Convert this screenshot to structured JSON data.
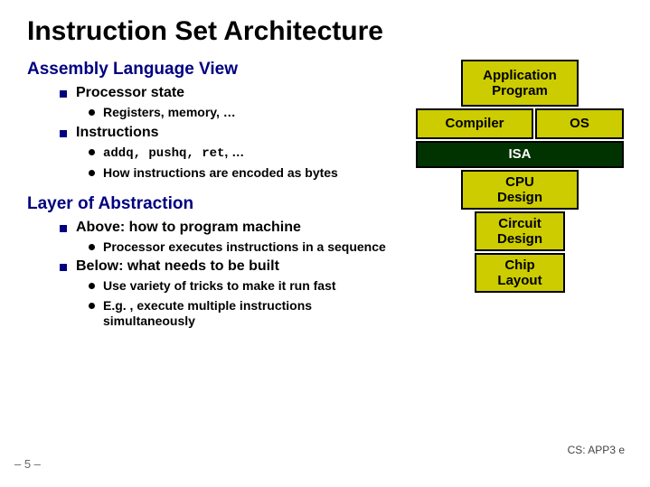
{
  "title": "Instruction Set Architecture",
  "section1": {
    "heading": "Assembly Language View",
    "item1": {
      "label": "Processor state",
      "sub1": "Registers, memory, …"
    },
    "item2": {
      "label": "Instructions",
      "sub1_code": "addq, pushq, ret",
      "sub1_tail": ", …",
      "sub2": "How instructions are encoded as bytes"
    }
  },
  "section2": {
    "heading": "Layer of Abstraction",
    "item1": {
      "label": "Above: how to program machine",
      "sub1": "Processor executes instructions in a sequence"
    },
    "item2": {
      "label": "Below: what needs to be built",
      "sub1": "Use variety of tricks to make it run fast",
      "sub2": "E.g. , execute multiple instructions simultaneously"
    }
  },
  "diagram": {
    "app": "Application\nProgram",
    "compiler": "Compiler",
    "os": "OS",
    "isa": "ISA",
    "cpu": "CPU\nDesign",
    "circuit": "Circuit\nDesign",
    "chip": "Chip\nLayout"
  },
  "footer": {
    "page": "– 5 –",
    "right": "CS: APP3 e"
  }
}
